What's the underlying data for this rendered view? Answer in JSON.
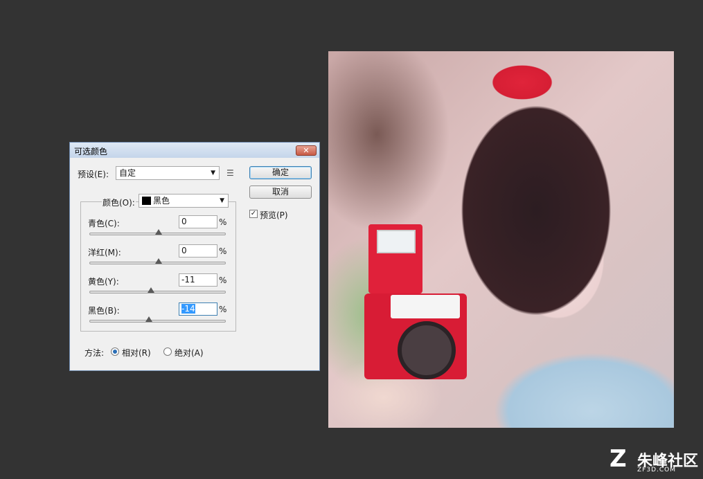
{
  "dialog": {
    "title": "可选颜色",
    "close_label": "✕",
    "preset_label": "预设(E):",
    "preset_value": "自定",
    "ok_label": "确定",
    "cancel_label": "取消",
    "preview_label": "预览(P)",
    "preview_checked": true,
    "color_label": "颜色(O):",
    "color_value": "黑色",
    "sliders": [
      {
        "label": "青色(C):",
        "value": "0",
        "unit": "%",
        "thumb_fraction": 0.5
      },
      {
        "label": "洋红(M):",
        "value": "0",
        "unit": "%",
        "thumb_fraction": 0.5
      },
      {
        "label": "黄色(Y):",
        "value": "-11",
        "unit": "%",
        "thumb_fraction": 0.445
      },
      {
        "label": "黑色(B):",
        "value": "-14",
        "unit": "%",
        "thumb_fraction": 0.43
      }
    ],
    "method_label": "方法:",
    "method_options": [
      "相对(R)",
      "绝对(A)"
    ],
    "method_selected": "相对(R)"
  },
  "watermark": {
    "logo": "Z",
    "brand": "朱峰社区",
    "site": "ZF3D.COM"
  }
}
